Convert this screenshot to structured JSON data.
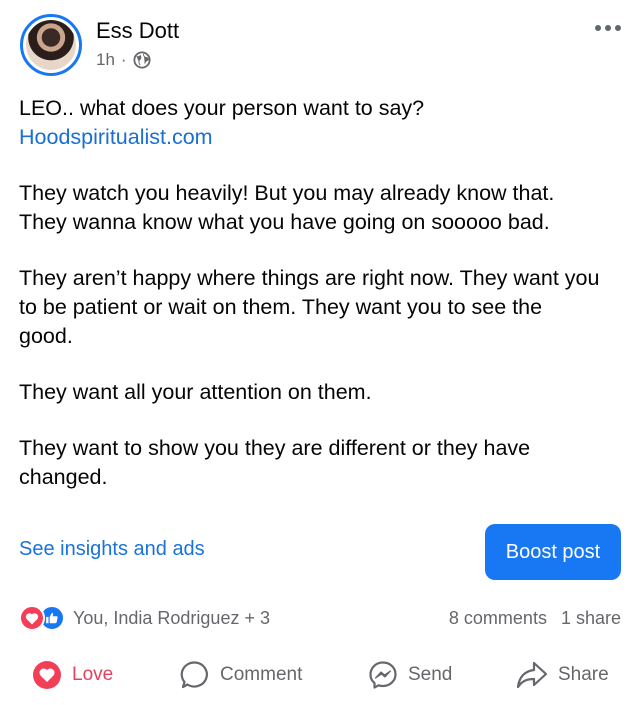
{
  "post": {
    "author": "Ess Dott",
    "time": "1h",
    "meta_separator": "·",
    "lines": {
      "l1": "LEO.. what does your person want to say?",
      "link": "Hoodspiritualist.com",
      "p2a": "They watch you heavily! But you may already know that.",
      "p2b": "They wanna know what you have going on sooooo bad.",
      "p3a": "They aren’t happy where things are right now. They want you",
      "p3b": "to be patient or wait on them. They want you to see the",
      "p3c": "good.",
      "p4": "They want all your attention on them.",
      "p5a": "They want to show you they are different or they have",
      "p5b": "changed."
    }
  },
  "promo": {
    "insights_label": "See insights and ads",
    "boost_label": "Boost post"
  },
  "engagement": {
    "reactors": "You, India Rodriguez + 3",
    "comments": "8 comments",
    "shares": "1 share"
  },
  "actions": {
    "love": "Love",
    "comment": "Comment",
    "send": "Send",
    "share": "Share"
  },
  "colors": {
    "accent": "#1877f2",
    "love": "#f33e58",
    "link": "#1a6fd1",
    "muted": "#65676b"
  },
  "icons": [
    "globe-icon",
    "more-options-icon",
    "love-reaction-icon",
    "like-reaction-icon",
    "love-icon",
    "comment-icon",
    "messenger-icon",
    "share-icon"
  ]
}
